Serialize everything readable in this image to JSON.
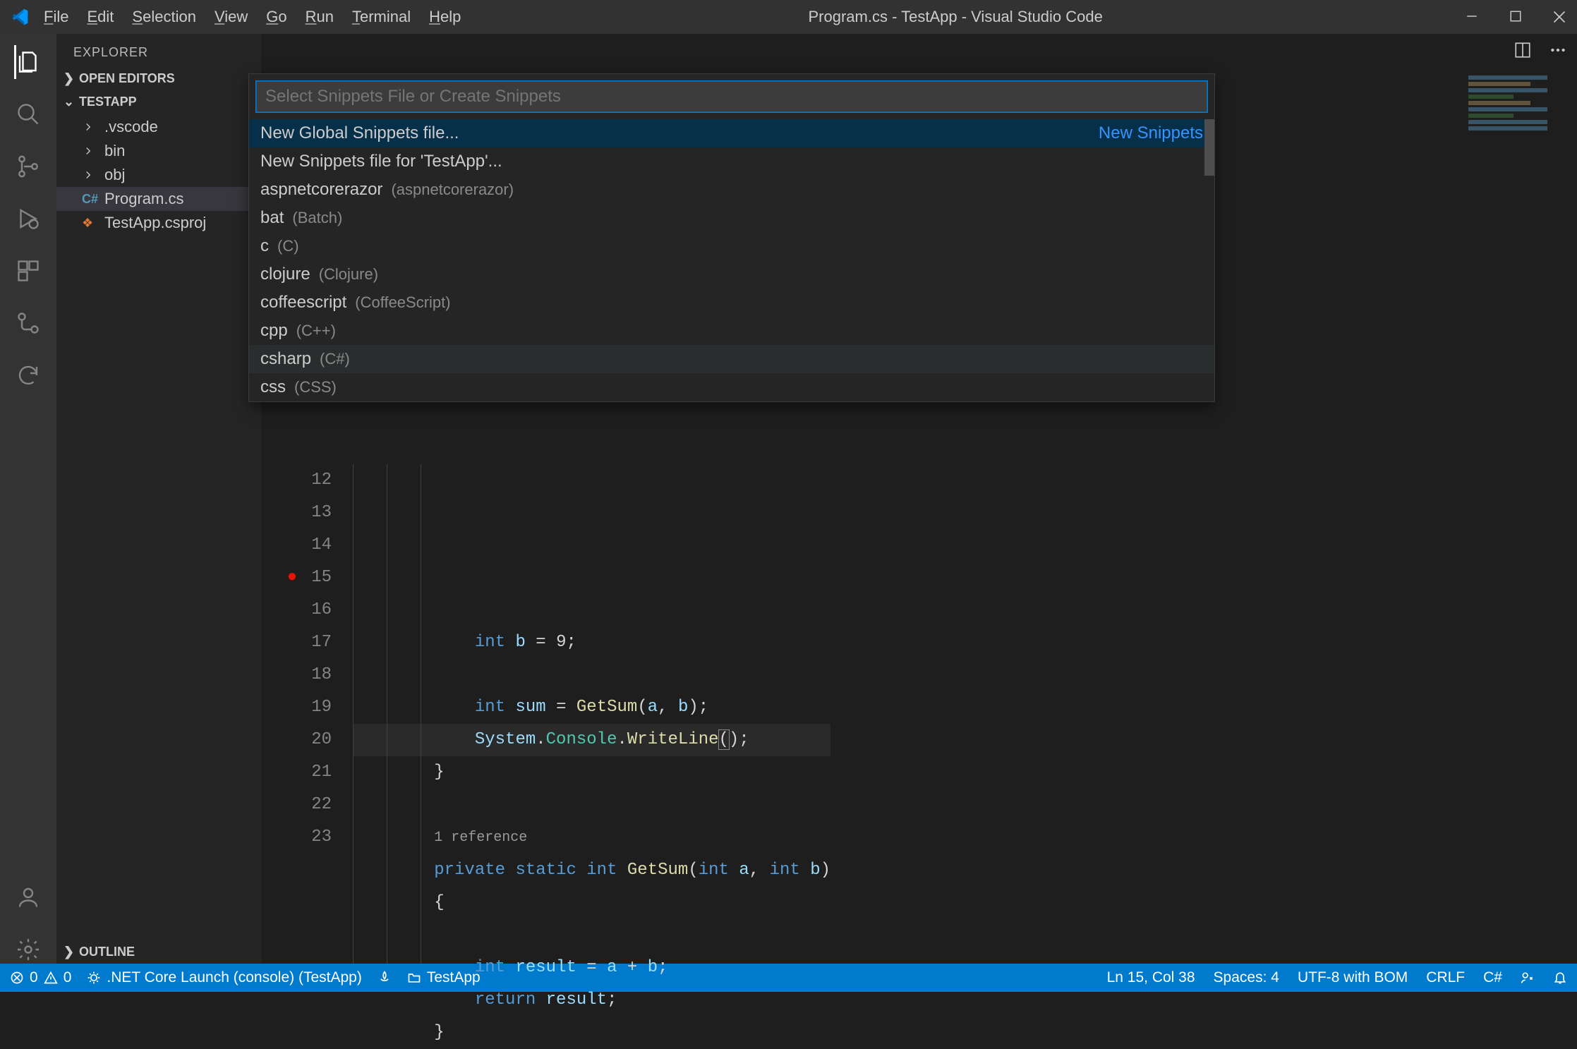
{
  "title": "Program.cs - TestApp - Visual Studio Code",
  "menu": {
    "file": "File",
    "edit": "Edit",
    "selection": "Selection",
    "view": "View",
    "go": "Go",
    "run": "Run",
    "terminal": "Terminal",
    "help": "Help"
  },
  "sidebar": {
    "title": "EXPLORER",
    "openEditors": "OPEN EDITORS",
    "project": "TESTAPP",
    "outline": "OUTLINE",
    "tree": [
      {
        "label": ".vscode",
        "kind": "folder"
      },
      {
        "label": "bin",
        "kind": "folder"
      },
      {
        "label": "obj",
        "kind": "folder"
      },
      {
        "label": "Program.cs",
        "kind": "cs",
        "selected": true
      },
      {
        "label": "TestApp.csproj",
        "kind": "xml"
      }
    ]
  },
  "quickInput": {
    "placeholder": "Select Snippets File or Create Snippets",
    "detailLabel": "New Snippets",
    "items": [
      {
        "label": "New Global Snippets file...",
        "desc": "",
        "selected": true,
        "detail": true
      },
      {
        "label": "New Snippets file for 'TestApp'...",
        "desc": ""
      },
      {
        "label": "aspnetcorerazor",
        "desc": "(aspnetcorerazor)"
      },
      {
        "label": "bat",
        "desc": "(Batch)"
      },
      {
        "label": "c",
        "desc": "(C)"
      },
      {
        "label": "clojure",
        "desc": "(Clojure)"
      },
      {
        "label": "coffeescript",
        "desc": "(CoffeeScript)"
      },
      {
        "label": "cpp",
        "desc": "(C++)"
      },
      {
        "label": "csharp",
        "desc": "(C#)",
        "hover": true
      },
      {
        "label": "css",
        "desc": "(CSS)"
      }
    ]
  },
  "code": {
    "startLine": 12,
    "breakpointLine": 15,
    "lines": [
      {
        "n": 12,
        "html": "            <span class='kw'>int</span> <span class='id'>b</span> <span class='op'>=</span> <span class='p'>9;</span>"
      },
      {
        "n": 13,
        "html": ""
      },
      {
        "n": 14,
        "html": "            <span class='kw'>int</span> <span class='id'>sum</span> <span class='op'>=</span> <span class='m'>GetSum</span><span class='p'>(</span><span class='id'>a</span><span class='p'>,</span> <span class='id'>b</span><span class='p'>);</span>"
      },
      {
        "n": 15,
        "html": "            <span class='id'>System</span><span class='p'>.</span><span class='t'>Console</span><span class='p'>.</span><span class='m'>WriteLine</span><span class='caret-box'><span class='p'>(</span></span><span class='p'>);</span>",
        "hl": true
      },
      {
        "n": 16,
        "html": "        <span class='p'>}</span>"
      },
      {
        "n": 17,
        "html": ""
      },
      {
        "n": "",
        "html": "        <span class='codelens'>1 reference</span>"
      },
      {
        "n": 18,
        "html": "        <span class='kw'>private</span> <span class='kw'>static</span> <span class='kw'>int</span> <span class='m'>GetSum</span><span class='p'>(</span><span class='kw'>int</span> <span class='id'>a</span><span class='p'>,</span> <span class='kw'>int</span> <span class='id'>b</span><span class='p'>)</span>"
      },
      {
        "n": 19,
        "html": "        <span class='p'>{</span>"
      },
      {
        "n": 20,
        "html": ""
      },
      {
        "n": 21,
        "html": "            <span class='kw'>int</span> <span class='id'>result</span> <span class='op'>=</span> <span class='id'>a</span> <span class='op'>+</span> <span class='id'>b</span><span class='p'>;</span>"
      },
      {
        "n": 22,
        "html": "            <span class='kw'>return</span> <span class='id'>result</span><span class='p'>;</span>"
      },
      {
        "n": 23,
        "html": "        <span class='p'>}</span>"
      }
    ]
  },
  "status": {
    "errors": "0",
    "warnings": "0",
    "launch": ".NET Core Launch (console) (TestApp)",
    "project": "TestApp",
    "cursor": "Ln 15, Col 38",
    "spaces": "Spaces: 4",
    "encoding": "UTF-8 with BOM",
    "eol": "CRLF",
    "lang": "C#"
  }
}
